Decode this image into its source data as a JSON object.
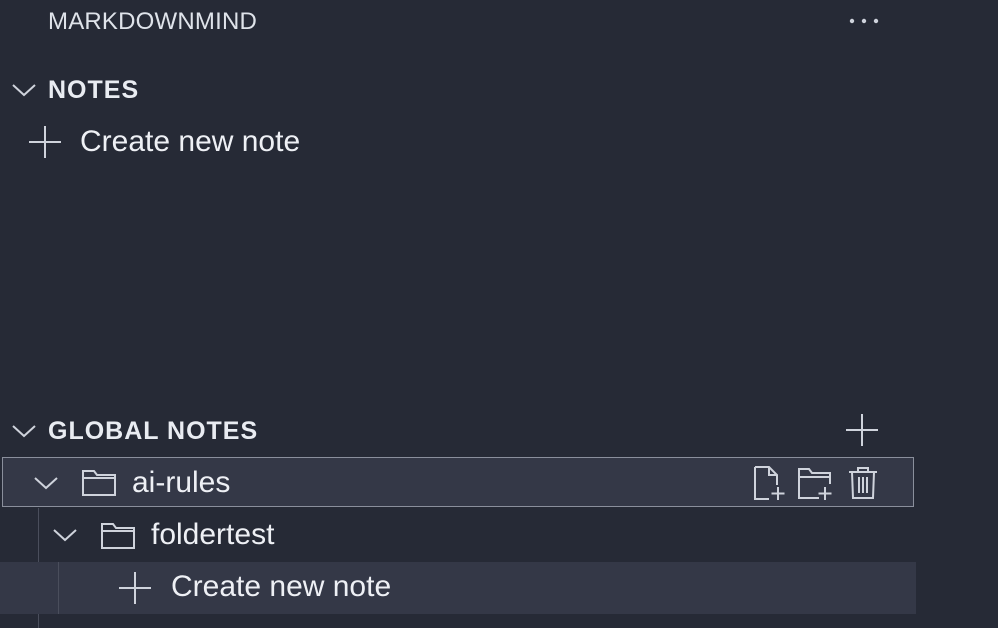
{
  "app": {
    "title": "MARKDOWNMIND"
  },
  "sections": {
    "notes": {
      "title": "NOTES",
      "create_label": "Create new note"
    },
    "global_notes": {
      "title": "GLOBAL NOTES",
      "tree": {
        "root_folder": {
          "name": "ai-rules",
          "actions": [
            "new-file-icon",
            "new-folder-icon",
            "trash-icon"
          ]
        },
        "sub_folder": {
          "name": "foldertest",
          "create_label": "Create new note"
        }
      }
    }
  },
  "icons": {
    "more": "ellipsis-icon",
    "expand": "chevron-down-icon",
    "add": "plus-icon",
    "folder": "folder-icon"
  },
  "colors": {
    "background": "#262a36",
    "row_highlight": "#343847",
    "row_border": "#8a8f9c",
    "text": "#eef0f5"
  }
}
